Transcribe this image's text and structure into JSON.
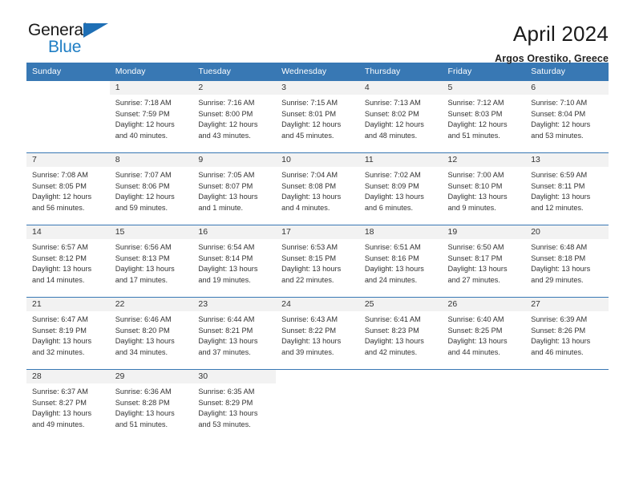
{
  "logo": {
    "word_one": "General",
    "word_two": "Blue",
    "triangle_color": "#1f6fb5",
    "blue_color": "#1f7ec4"
  },
  "header": {
    "title": "April 2024",
    "subtitle": "Argos Orestiko, Greece",
    "accent_color": "#3878b4"
  },
  "weekday_headers": [
    "Sunday",
    "Monday",
    "Tuesday",
    "Wednesday",
    "Thursday",
    "Friday",
    "Saturday"
  ],
  "weeks": [
    [
      {
        "day": "",
        "sunrise": "",
        "sunset": "",
        "daylight_line1": "",
        "daylight_line2": ""
      },
      {
        "day": "1",
        "sunrise": "Sunrise: 7:18 AM",
        "sunset": "Sunset: 7:59 PM",
        "daylight_line1": "Daylight: 12 hours",
        "daylight_line2": "and 40 minutes."
      },
      {
        "day": "2",
        "sunrise": "Sunrise: 7:16 AM",
        "sunset": "Sunset: 8:00 PM",
        "daylight_line1": "Daylight: 12 hours",
        "daylight_line2": "and 43 minutes."
      },
      {
        "day": "3",
        "sunrise": "Sunrise: 7:15 AM",
        "sunset": "Sunset: 8:01 PM",
        "daylight_line1": "Daylight: 12 hours",
        "daylight_line2": "and 45 minutes."
      },
      {
        "day": "4",
        "sunrise": "Sunrise: 7:13 AM",
        "sunset": "Sunset: 8:02 PM",
        "daylight_line1": "Daylight: 12 hours",
        "daylight_line2": "and 48 minutes."
      },
      {
        "day": "5",
        "sunrise": "Sunrise: 7:12 AM",
        "sunset": "Sunset: 8:03 PM",
        "daylight_line1": "Daylight: 12 hours",
        "daylight_line2": "and 51 minutes."
      },
      {
        "day": "6",
        "sunrise": "Sunrise: 7:10 AM",
        "sunset": "Sunset: 8:04 PM",
        "daylight_line1": "Daylight: 12 hours",
        "daylight_line2": "and 53 minutes."
      }
    ],
    [
      {
        "day": "7",
        "sunrise": "Sunrise: 7:08 AM",
        "sunset": "Sunset: 8:05 PM",
        "daylight_line1": "Daylight: 12 hours",
        "daylight_line2": "and 56 minutes."
      },
      {
        "day": "8",
        "sunrise": "Sunrise: 7:07 AM",
        "sunset": "Sunset: 8:06 PM",
        "daylight_line1": "Daylight: 12 hours",
        "daylight_line2": "and 59 minutes."
      },
      {
        "day": "9",
        "sunrise": "Sunrise: 7:05 AM",
        "sunset": "Sunset: 8:07 PM",
        "daylight_line1": "Daylight: 13 hours",
        "daylight_line2": "and 1 minute."
      },
      {
        "day": "10",
        "sunrise": "Sunrise: 7:04 AM",
        "sunset": "Sunset: 8:08 PM",
        "daylight_line1": "Daylight: 13 hours",
        "daylight_line2": "and 4 minutes."
      },
      {
        "day": "11",
        "sunrise": "Sunrise: 7:02 AM",
        "sunset": "Sunset: 8:09 PM",
        "daylight_line1": "Daylight: 13 hours",
        "daylight_line2": "and 6 minutes."
      },
      {
        "day": "12",
        "sunrise": "Sunrise: 7:00 AM",
        "sunset": "Sunset: 8:10 PM",
        "daylight_line1": "Daylight: 13 hours",
        "daylight_line2": "and 9 minutes."
      },
      {
        "day": "13",
        "sunrise": "Sunrise: 6:59 AM",
        "sunset": "Sunset: 8:11 PM",
        "daylight_line1": "Daylight: 13 hours",
        "daylight_line2": "and 12 minutes."
      }
    ],
    [
      {
        "day": "14",
        "sunrise": "Sunrise: 6:57 AM",
        "sunset": "Sunset: 8:12 PM",
        "daylight_line1": "Daylight: 13 hours",
        "daylight_line2": "and 14 minutes."
      },
      {
        "day": "15",
        "sunrise": "Sunrise: 6:56 AM",
        "sunset": "Sunset: 8:13 PM",
        "daylight_line1": "Daylight: 13 hours",
        "daylight_line2": "and 17 minutes."
      },
      {
        "day": "16",
        "sunrise": "Sunrise: 6:54 AM",
        "sunset": "Sunset: 8:14 PM",
        "daylight_line1": "Daylight: 13 hours",
        "daylight_line2": "and 19 minutes."
      },
      {
        "day": "17",
        "sunrise": "Sunrise: 6:53 AM",
        "sunset": "Sunset: 8:15 PM",
        "daylight_line1": "Daylight: 13 hours",
        "daylight_line2": "and 22 minutes."
      },
      {
        "day": "18",
        "sunrise": "Sunrise: 6:51 AM",
        "sunset": "Sunset: 8:16 PM",
        "daylight_line1": "Daylight: 13 hours",
        "daylight_line2": "and 24 minutes."
      },
      {
        "day": "19",
        "sunrise": "Sunrise: 6:50 AM",
        "sunset": "Sunset: 8:17 PM",
        "daylight_line1": "Daylight: 13 hours",
        "daylight_line2": "and 27 minutes."
      },
      {
        "day": "20",
        "sunrise": "Sunrise: 6:48 AM",
        "sunset": "Sunset: 8:18 PM",
        "daylight_line1": "Daylight: 13 hours",
        "daylight_line2": "and 29 minutes."
      }
    ],
    [
      {
        "day": "21",
        "sunrise": "Sunrise: 6:47 AM",
        "sunset": "Sunset: 8:19 PM",
        "daylight_line1": "Daylight: 13 hours",
        "daylight_line2": "and 32 minutes."
      },
      {
        "day": "22",
        "sunrise": "Sunrise: 6:46 AM",
        "sunset": "Sunset: 8:20 PM",
        "daylight_line1": "Daylight: 13 hours",
        "daylight_line2": "and 34 minutes."
      },
      {
        "day": "23",
        "sunrise": "Sunrise: 6:44 AM",
        "sunset": "Sunset: 8:21 PM",
        "daylight_line1": "Daylight: 13 hours",
        "daylight_line2": "and 37 minutes."
      },
      {
        "day": "24",
        "sunrise": "Sunrise: 6:43 AM",
        "sunset": "Sunset: 8:22 PM",
        "daylight_line1": "Daylight: 13 hours",
        "daylight_line2": "and 39 minutes."
      },
      {
        "day": "25",
        "sunrise": "Sunrise: 6:41 AM",
        "sunset": "Sunset: 8:23 PM",
        "daylight_line1": "Daylight: 13 hours",
        "daylight_line2": "and 42 minutes."
      },
      {
        "day": "26",
        "sunrise": "Sunrise: 6:40 AM",
        "sunset": "Sunset: 8:25 PM",
        "daylight_line1": "Daylight: 13 hours",
        "daylight_line2": "and 44 minutes."
      },
      {
        "day": "27",
        "sunrise": "Sunrise: 6:39 AM",
        "sunset": "Sunset: 8:26 PM",
        "daylight_line1": "Daylight: 13 hours",
        "daylight_line2": "and 46 minutes."
      }
    ],
    [
      {
        "day": "28",
        "sunrise": "Sunrise: 6:37 AM",
        "sunset": "Sunset: 8:27 PM",
        "daylight_line1": "Daylight: 13 hours",
        "daylight_line2": "and 49 minutes."
      },
      {
        "day": "29",
        "sunrise": "Sunrise: 6:36 AM",
        "sunset": "Sunset: 8:28 PM",
        "daylight_line1": "Daylight: 13 hours",
        "daylight_line2": "and 51 minutes."
      },
      {
        "day": "30",
        "sunrise": "Sunrise: 6:35 AM",
        "sunset": "Sunset: 8:29 PM",
        "daylight_line1": "Daylight: 13 hours",
        "daylight_line2": "and 53 minutes."
      },
      {
        "day": "",
        "sunrise": "",
        "sunset": "",
        "daylight_line1": "",
        "daylight_line2": ""
      },
      {
        "day": "",
        "sunrise": "",
        "sunset": "",
        "daylight_line1": "",
        "daylight_line2": ""
      },
      {
        "day": "",
        "sunrise": "",
        "sunset": "",
        "daylight_line1": "",
        "daylight_line2": ""
      },
      {
        "day": "",
        "sunrise": "",
        "sunset": "",
        "daylight_line1": "",
        "daylight_line2": ""
      }
    ]
  ]
}
